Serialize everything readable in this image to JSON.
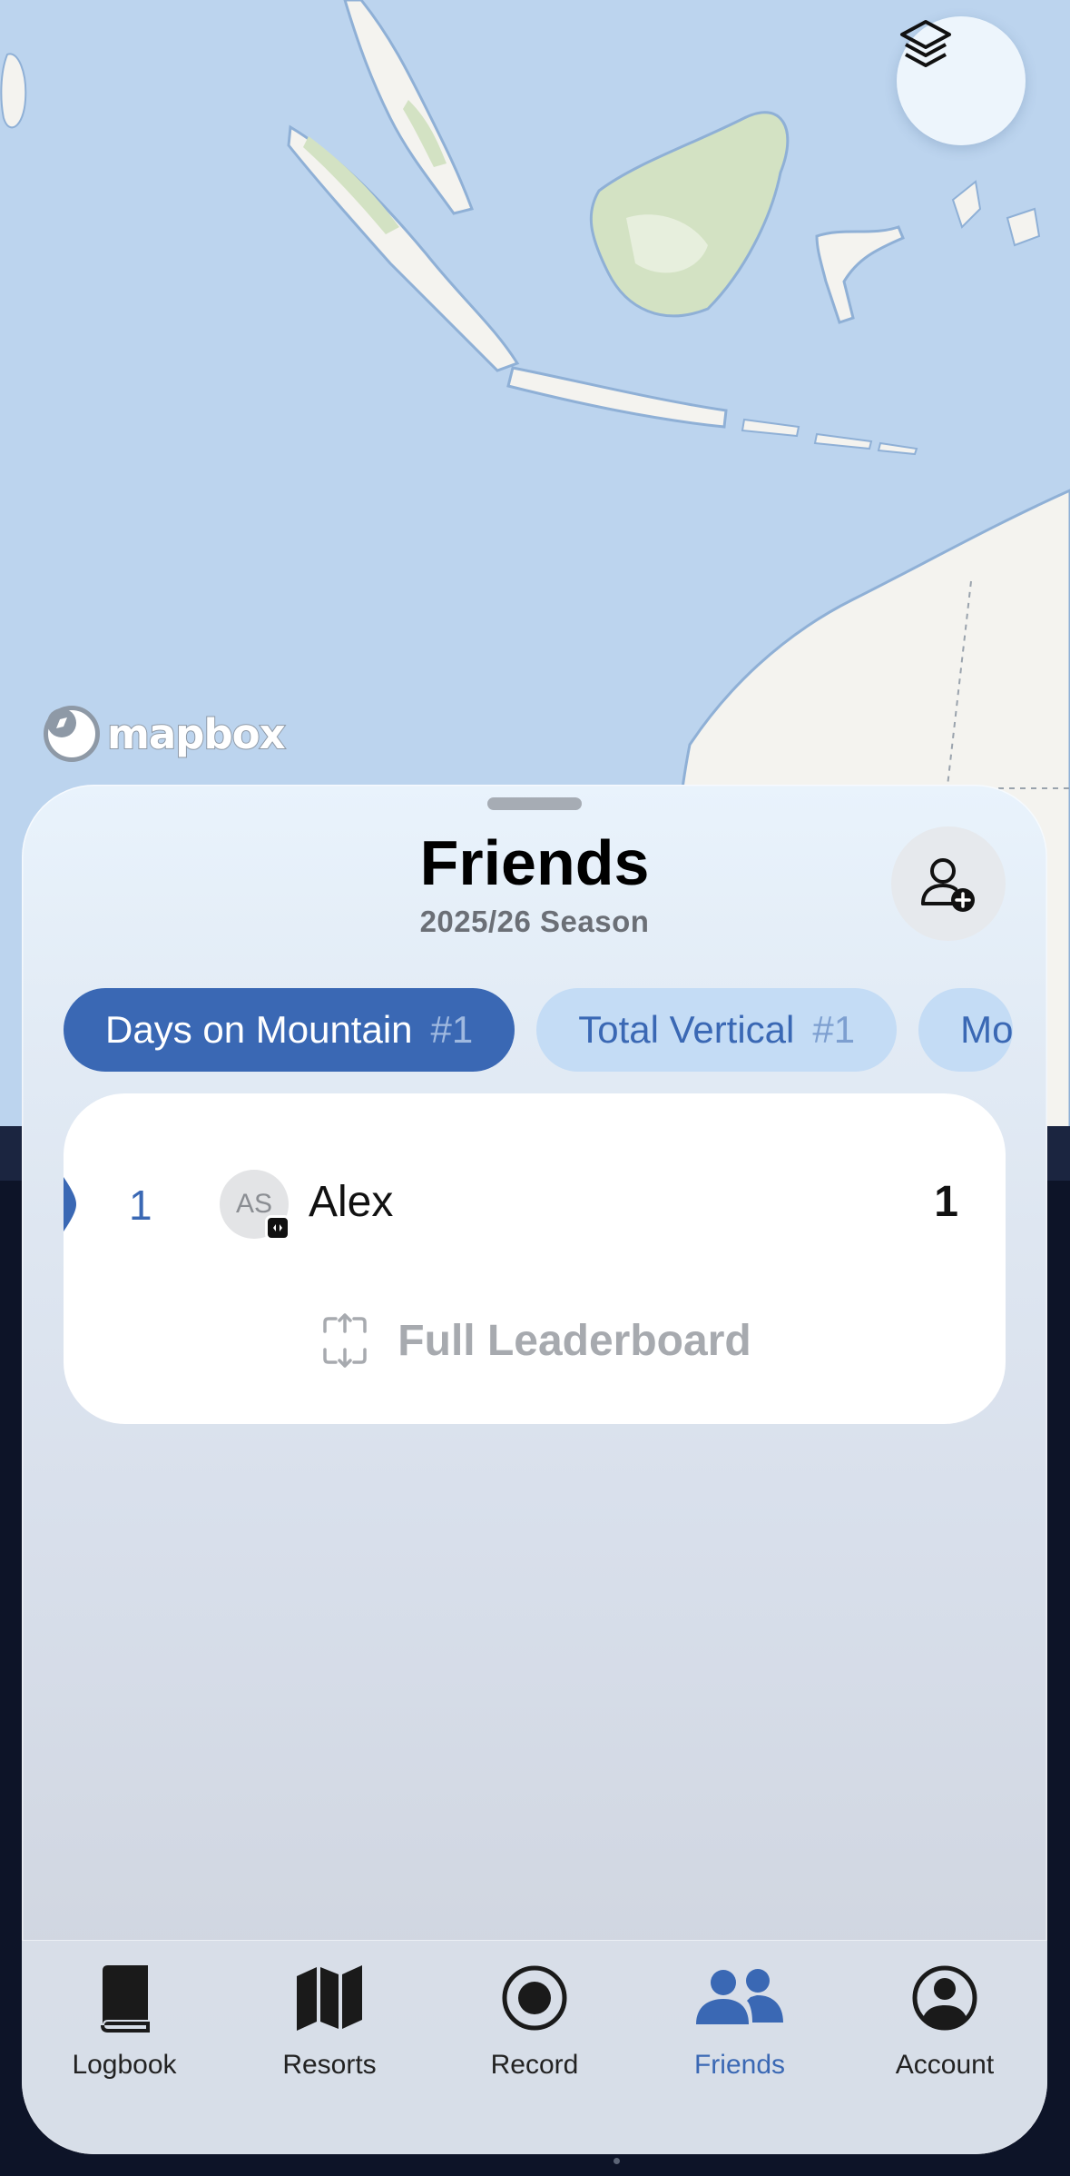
{
  "map": {
    "attribution": "mapbox",
    "layers_icon": "stack-layers-icon",
    "colors": {
      "ocean": "#bcd4ee",
      "land": "#f4f3ef",
      "vegetation": "#d3e2c3"
    }
  },
  "sheet": {
    "title": "Friends",
    "subtitle": "2025/26 Season",
    "add_friend_icon": "person-plus-icon"
  },
  "pills": [
    {
      "label": "Days on Mountain",
      "rank": "#1",
      "active": true
    },
    {
      "label": "Total Vertical",
      "rank": "#1",
      "active": false
    },
    {
      "label": "Mo",
      "rank": "",
      "active": false
    }
  ],
  "leaderboard": {
    "rows": [
      {
        "rank": "1",
        "initials": "AS",
        "name": "Alex",
        "value": "1"
      }
    ],
    "full_label": "Full Leaderboard"
  },
  "tabs": [
    {
      "label": "Logbook",
      "icon": "book-icon",
      "active": false
    },
    {
      "label": "Resorts",
      "icon": "map-icon",
      "active": false
    },
    {
      "label": "Record",
      "icon": "record-icon",
      "active": false
    },
    {
      "label": "Friends",
      "icon": "people-icon",
      "active": true
    },
    {
      "label": "Account",
      "icon": "account-icon",
      "active": false
    }
  ],
  "colors": {
    "accent": "#3a68b4",
    "pill_inactive": "#c4dcf5",
    "muted_text": "#a7aaaf"
  }
}
